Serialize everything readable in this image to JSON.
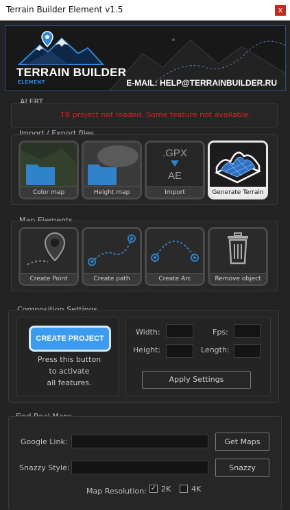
{
  "window": {
    "title": "Terrain Builder Element v1.5",
    "close": "x"
  },
  "banner": {
    "logo_title": "TERRAIN BUILDER",
    "logo_sub": "ELEMENT",
    "email": "E-MAIL: HELP@TERRAINBUILDER.RU"
  },
  "alert": {
    "label": "ALERT",
    "message": "TB project not loaded. Some feature not available.",
    "color": "#e02020"
  },
  "import_export": {
    "label": "Import / Export files",
    "tiles": [
      {
        "label": "Color map",
        "icon": "folder-icon"
      },
      {
        "label": "Height map",
        "icon": "folder-icon"
      },
      {
        "label": "Import",
        "icon": "gpx-to-ae-icon",
        "gpx": ".GPX",
        "ae": "AE"
      },
      {
        "label": "Generate Terrain",
        "icon": "terrain-mesh-icon"
      }
    ]
  },
  "map_elements": {
    "label": "Map Elements",
    "tiles": [
      {
        "label": "Create Point",
        "icon": "map-pin-icon"
      },
      {
        "label": "Create path",
        "icon": "path-icon"
      },
      {
        "label": "Create Arc",
        "icon": "arc-icon"
      },
      {
        "label": "Remove object",
        "icon": "trash-icon"
      }
    ]
  },
  "composition": {
    "label": "Composition Settings",
    "create_button": "CREATE PROJECT",
    "hint_lines": [
      "Press this button",
      "to activate",
      "all features."
    ],
    "width_label": "Width:",
    "height_label": "Height:",
    "fps_label": "Fps:",
    "length_label": "Length:",
    "width_value": "",
    "height_value": "",
    "fps_value": "",
    "length_value": "",
    "apply_button": "Apply Settings"
  },
  "real_maps": {
    "label": "Find Real Maps",
    "google_label": "Google Link:",
    "google_value": "",
    "get_maps_button": "Get Maps",
    "snazzy_label": "Snazzy Style:",
    "snazzy_value": "",
    "snazzy_button": "Snazzy",
    "resolution_label": "Map Resolution:",
    "option_2k": "2K",
    "option_2k_checked": true,
    "option_4k": "4K",
    "option_4k_checked": false
  },
  "colors": {
    "accent": "#3b9bef",
    "background": "#232323"
  }
}
